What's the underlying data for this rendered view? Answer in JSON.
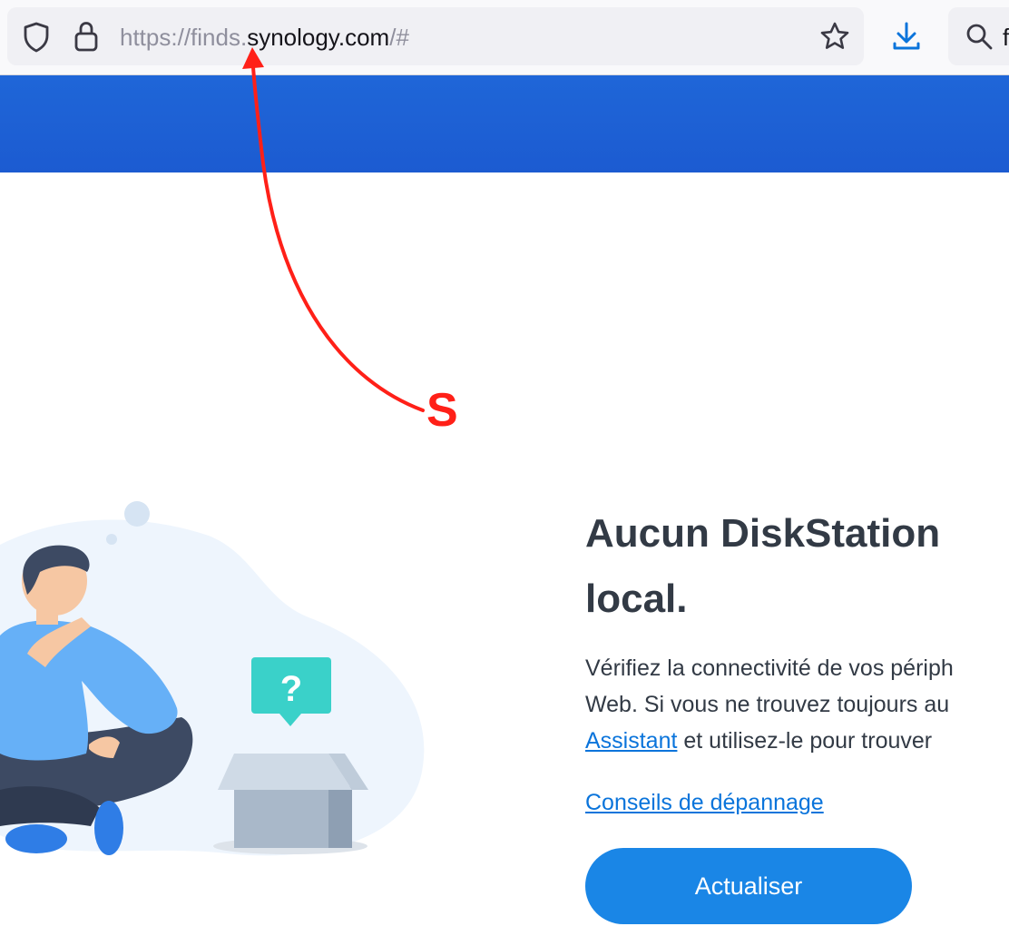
{
  "browser": {
    "url_prefix": "https://finds.",
    "url_domain": "synology.com",
    "url_suffix": "/#",
    "search_partial": "f"
  },
  "annotation": {
    "label": "S",
    "color": "#ff2018"
  },
  "message": {
    "heading_line1": "Aucun DiskStation",
    "heading_line2": "local.",
    "desc_line1": "Vérifiez la connectivité de vos périph",
    "desc_line2": "Web. Si vous ne trouvez toujours au",
    "desc_link": "Assistant",
    "desc_line3_rest": " et utilisez-le pour trouver",
    "troubleshoot_link": "Conseils de dépannage",
    "refresh_button": "Actualiser"
  },
  "illustration": {
    "question_mark": "?"
  },
  "colors": {
    "header_blue": "#1f66d8",
    "link_blue": "#0a74db",
    "button_blue": "#1a86e6",
    "heading_text": "#323a45"
  }
}
